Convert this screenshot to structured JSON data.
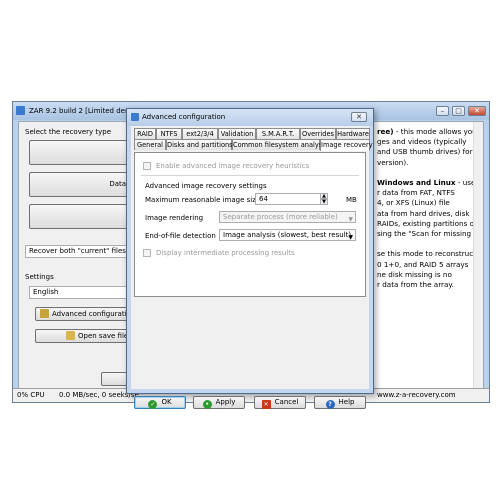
{
  "main_window": {
    "title": "ZAR 9.2 build 2 [Limited demo",
    "min_glyph": "–",
    "max_glyph": "□",
    "close_glyph": "✕",
    "select_mode_label": "Select the recovery type",
    "mode_buttons": [
      {
        "label": "Ir"
      },
      {
        "label": "Data Rec"
      },
      {
        "label": ""
      }
    ],
    "recover_both_value": "Recover both \"current\" files and",
    "settings_label": "Settings",
    "language_value": "English",
    "advanced_button": "Advanced configurati",
    "open_save_button": "Open save file",
    "right_panel_lines": [
      "ree) - this mode allows you",
      "ges and videos (typically",
      "and USB thumb drives) for",
      "version).",
      "",
      "Windows and Linux - use",
      "r data from FAT, NTFS",
      "4, or XFS (Linux) file",
      "ata from hard drives, disk",
      "RAIDs, existing partitions or",
      "sing the \"Scan for missing",
      "",
      "se this mode to reconstruct",
      "0 1+0, and RAID 5 arrays",
      "ne disk missing is no",
      "r data from the array."
    ],
    "status": {
      "cpu": "0% CPU",
      "speed": "0.0 MB/sec, 0 seeks/se",
      "url": "www.z-a-recovery.com"
    }
  },
  "dialog": {
    "title": "Advanced configuration",
    "close_glyph": "✕",
    "tabs_row1": [
      "RAID",
      "NTFS",
      "ext2/3/4",
      "Validation",
      "S.M.A.R.T.",
      "Overrides",
      "Hardware"
    ],
    "tabs_row2": [
      "General",
      "Disks and partitions",
      "Common filesystem analysis",
      "Image recovery"
    ],
    "active_tab": "Image recovery",
    "enable_heuristics_label": "Enable advanced image recovery heuristics",
    "section_label": "Advanced image recovery settings",
    "max_size_label": "Maximum reasonable image size",
    "max_size_value": "64",
    "max_size_unit": "MB",
    "rendering_label": "Image rendering",
    "rendering_value": "Separate process (more reliable)",
    "eof_label": "End-of-file detection",
    "eof_value": "Image analysis (slowest, best result)",
    "display_intermediate_label": "Display intermediate processing results",
    "buttons": {
      "ok": "OK",
      "apply": "Apply",
      "cancel": "Cancel",
      "help": "Help"
    }
  },
  "colors": {
    "window_frame": "#b9d1ea",
    "ok_icon": "#2e9a2e",
    "apply_icon": "#2e9a2e",
    "cancel_icon": "#c43a1a",
    "help_icon": "#2a65c4"
  }
}
